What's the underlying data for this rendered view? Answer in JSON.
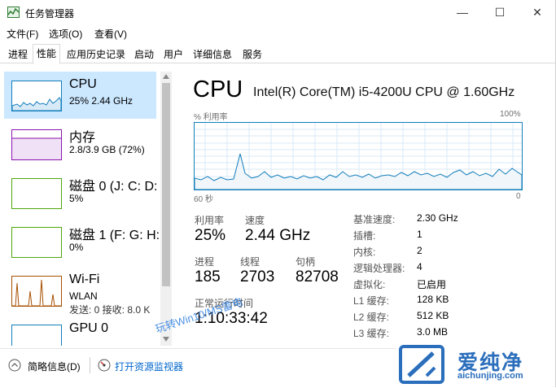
{
  "window": {
    "title": "任务管理器",
    "minimize": "—",
    "maximize": "☐",
    "close": "✕"
  },
  "menu": [
    "文件(F)",
    "选项(O)",
    "查看(V)"
  ],
  "tabs": [
    "进程",
    "性能",
    "应用历史记录",
    "启动",
    "用户",
    "详细信息",
    "服务"
  ],
  "active_tab": "性能",
  "sidebar": {
    "items": [
      {
        "name": "CPU",
        "sub": "25% 2.44 GHz",
        "sub2": "",
        "color": "#117dbb"
      },
      {
        "name": "内存",
        "sub": "2.8/3.9 GB (72%)",
        "sub2": "",
        "color": "#8b12ae"
      },
      {
        "name": "磁盘 0 (J: C: D:",
        "sub": "5%",
        "sub2": "",
        "color": "#4da60c"
      },
      {
        "name": "磁盘 1 (F: G: H:",
        "sub": "0%",
        "sub2": "",
        "color": "#4da60c"
      },
      {
        "name": "Wi-Fi",
        "sub": "WLAN",
        "sub2": "发送: 0 接收: 8.0 K",
        "color": "#a74f01"
      },
      {
        "name": "GPU 0",
        "sub": "",
        "sub2": "",
        "color": "#117dbb"
      }
    ]
  },
  "main": {
    "title": "CPU",
    "model": "Intel(R) Core(TM) i5-4200U CPU @ 1.60GHz",
    "graph_top_left": "% 利用率",
    "graph_top_right": "100%",
    "graph_bottom_left": "60 秒",
    "graph_bottom_right": "0",
    "stats": {
      "util_label": "利用率",
      "util_value": "25%",
      "speed_label": "速度",
      "speed_value": "2.44 GHz",
      "proc_label": "进程",
      "proc_value": "185",
      "thread_label": "线程",
      "thread_value": "2703",
      "handle_label": "句柄",
      "handle_value": "82708",
      "uptime_label": "正常运行时间",
      "uptime_value": "1:10:33:42"
    },
    "details": [
      {
        "label": "基准速度:",
        "value": "2.30 GHz"
      },
      {
        "label": "插槽:",
        "value": "1"
      },
      {
        "label": "内核:",
        "value": "2"
      },
      {
        "label": "逻辑处理器:",
        "value": "4"
      },
      {
        "label": "虚拟化:",
        "value": "已启用"
      },
      {
        "label": "L1 缓存:",
        "value": "128 KB"
      },
      {
        "label": "L2 缓存:",
        "value": "512 KB"
      },
      {
        "label": "L3 缓存:",
        "value": "3.0 MB"
      }
    ]
  },
  "bottom": {
    "less_details": "简略信息(D)",
    "open_monitor": "打开资源监视器"
  },
  "watermark": "玩转Win10/MS雷电",
  "brand": {
    "name": "爱纯净",
    "url": "aichunjing.com"
  },
  "colors": {
    "cpu": "#117dbb",
    "memory": "#8b12ae",
    "disk": "#4da60c",
    "wifi": "#a74f01",
    "brand": "#2a6ebc"
  }
}
